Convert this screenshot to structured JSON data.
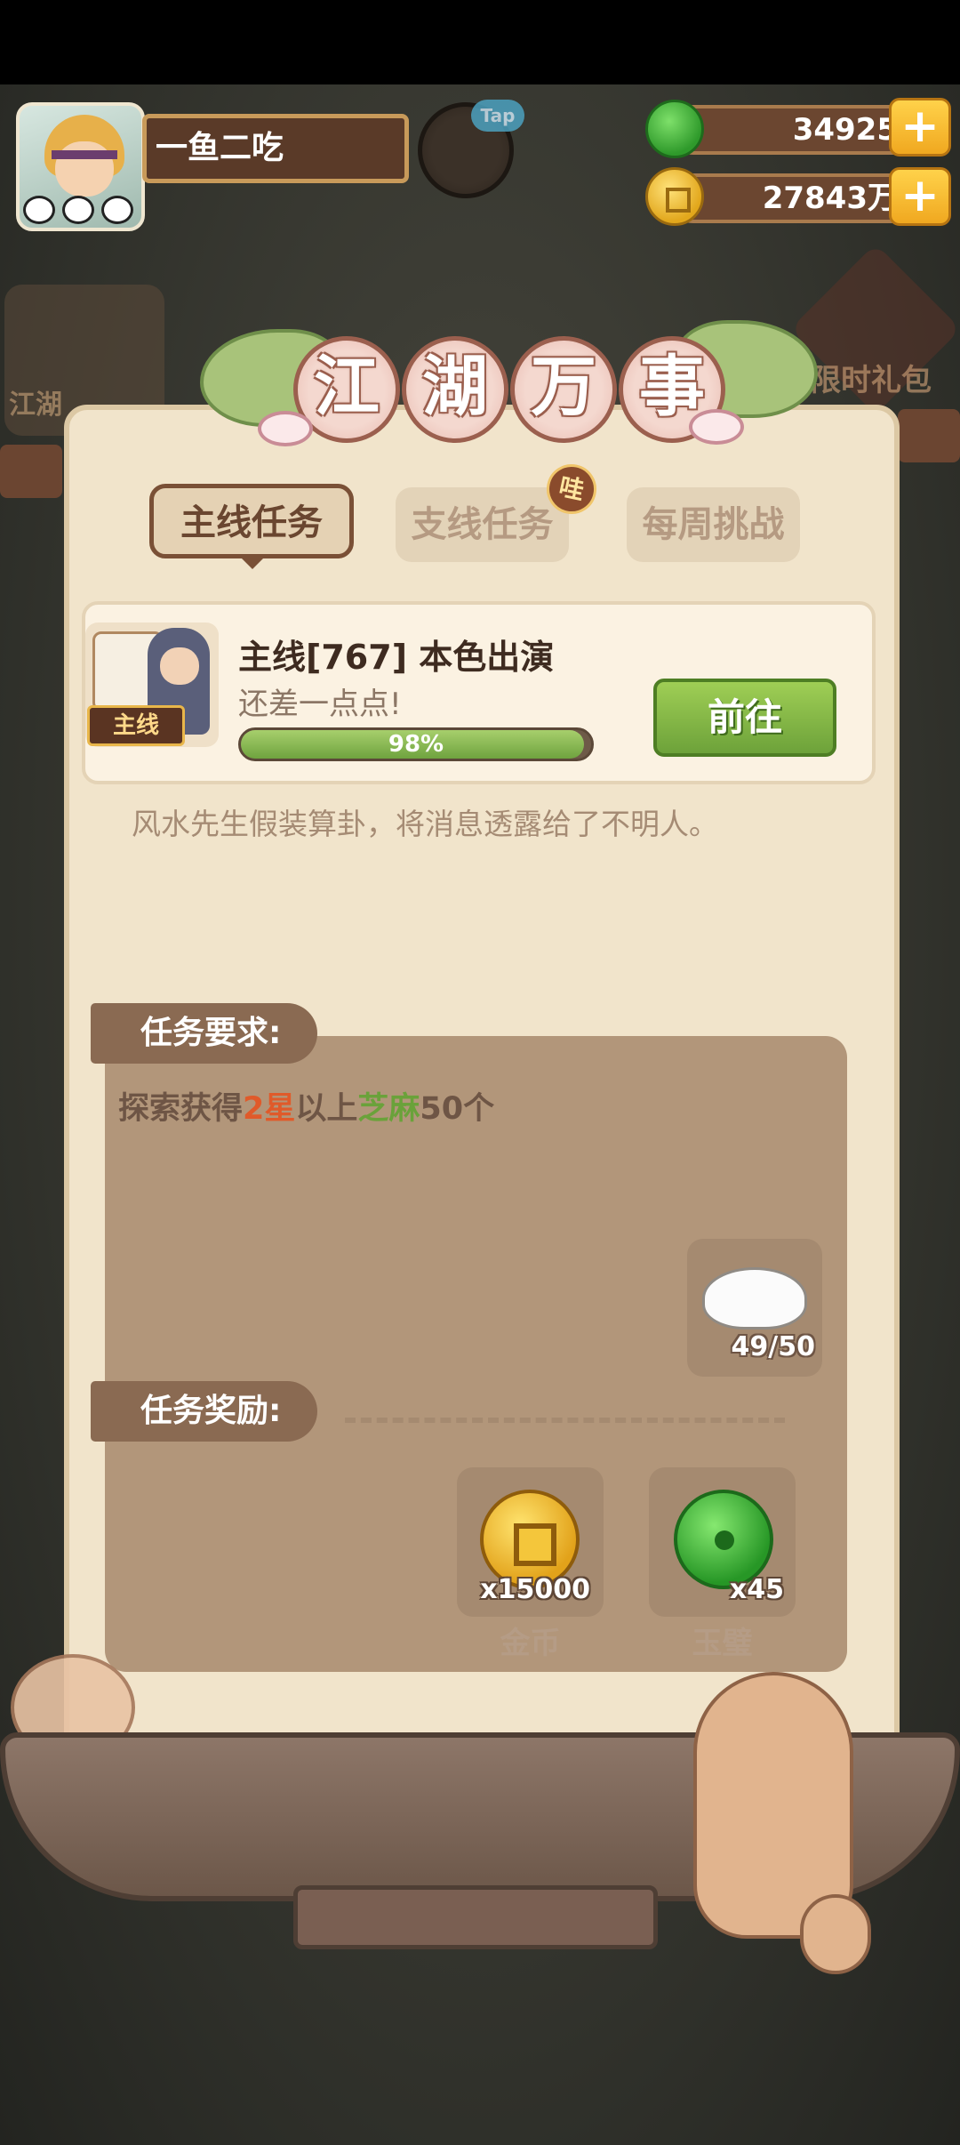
{
  "player": {
    "name": "一鱼二吃"
  },
  "header": {
    "tap_label": "Tap"
  },
  "resources": {
    "jade": {
      "value": "34925",
      "icon": "jade-icon"
    },
    "coins": {
      "value": "27843万",
      "icon": "coin-icon"
    },
    "plus_symbol": "+"
  },
  "side": {
    "left_event_label": "江湖",
    "right_gift_label": "限时礼包"
  },
  "panel": {
    "title_chars": [
      "江",
      "湖",
      "万",
      "事"
    ],
    "tabs": [
      {
        "label": "主线任务",
        "active": true
      },
      {
        "label": "支线任务",
        "badge": "哇"
      },
      {
        "label": "每周挑战"
      }
    ]
  },
  "quest": {
    "tag": "主线",
    "title": "主线[767] 本色出演",
    "subtitle": "还差一点点!",
    "progress_text": "98%",
    "progress_value": 0.98,
    "go_button": "前往",
    "description": "风水先生假装算卦，将消息透露给了不明人。"
  },
  "requirement": {
    "label": "任务要求:",
    "text_prefix": "探索获得",
    "star_text": "2星",
    "text_middle": "以上",
    "item_text": "芝麻",
    "text_suffix": "50个",
    "item_count": "49/50",
    "item_icon": "rice-icon"
  },
  "reward": {
    "label": "任务奖励:",
    "items": [
      {
        "qty": "x15000",
        "name": "金币",
        "icon": "gold-coin-icon"
      },
      {
        "qty": "x45",
        "name": "玉璧",
        "icon": "jade-disc-icon"
      }
    ]
  },
  "colors": {
    "accent_green": "#6da23a",
    "panel_bg": "#f1e4cb",
    "requirement_star": "#e05a2a",
    "requirement_item": "#6aa23a"
  }
}
